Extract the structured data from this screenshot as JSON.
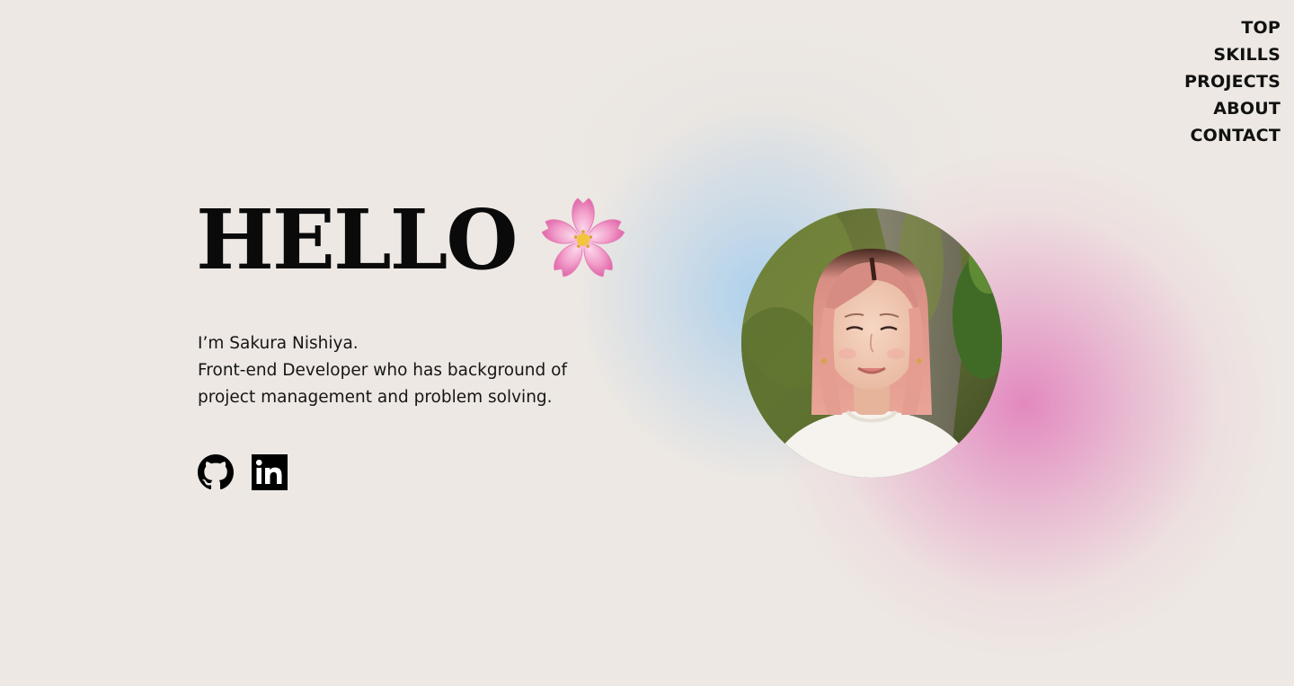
{
  "nav": {
    "items": [
      {
        "label": "TOP"
      },
      {
        "label": "SKILLS"
      },
      {
        "label": "PROJECTS"
      },
      {
        "label": "ABOUT"
      },
      {
        "label": "CONTACT"
      }
    ]
  },
  "hero": {
    "title": "HELLO",
    "title_icon": "cherry-blossom-icon",
    "intro_line1": "I’m Sakura Nishiya.",
    "intro_line2": "Front-end Developer who has background of project management and problem solving."
  },
  "social": {
    "icons": [
      "github-icon",
      "linkedin-icon"
    ]
  },
  "avatar": {
    "icon": "profile-photo"
  },
  "colors": {
    "background": "#ede8e3",
    "text": "#111111",
    "glow_blue": "#96c8f0",
    "glow_pink": "#e178b9",
    "flower_pink": "#f5a3cf"
  }
}
